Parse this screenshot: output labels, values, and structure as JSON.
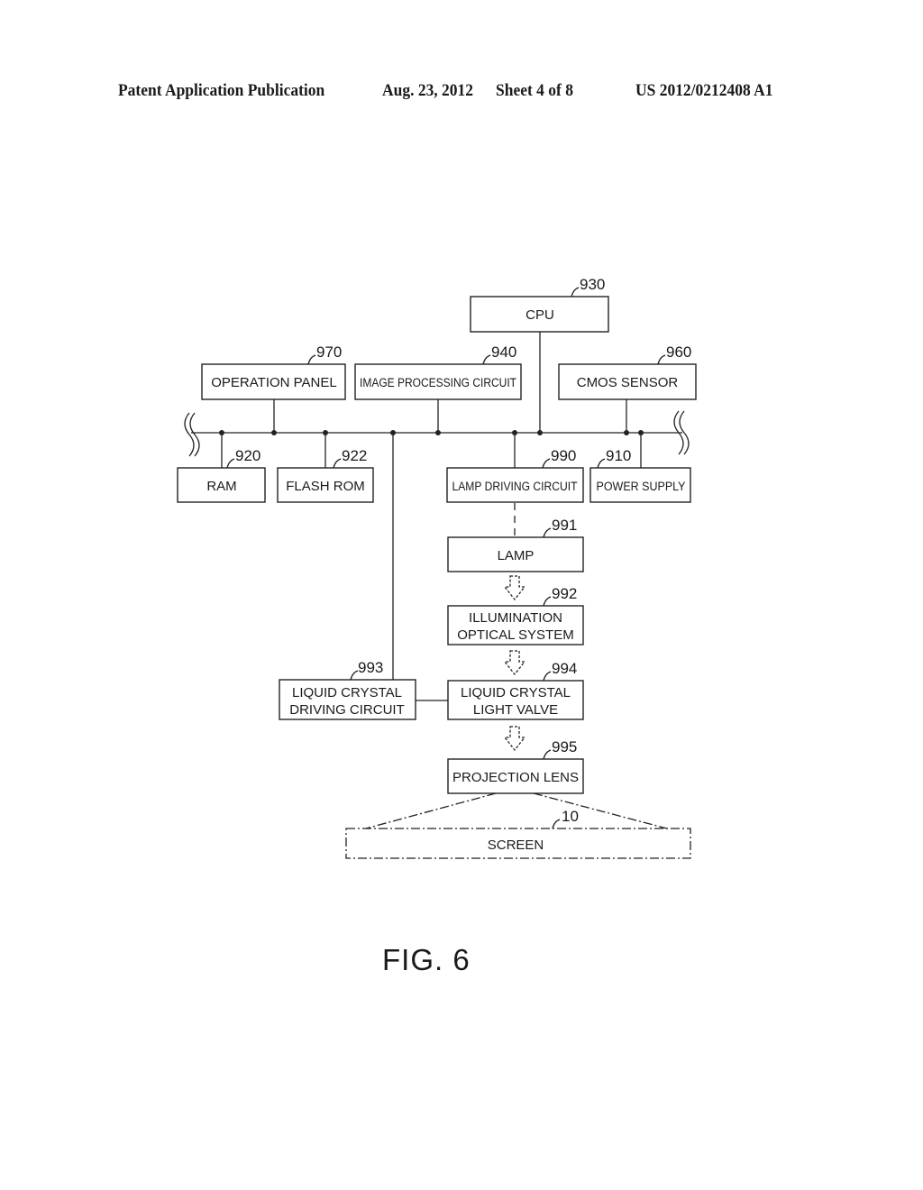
{
  "header": {
    "publication": "Patent Application Publication",
    "date": "Aug. 23, 2012",
    "sheet": "Sheet 4 of 8",
    "number": "US 2012/0212408 A1"
  },
  "figure_label": "FIG. 6",
  "blocks": {
    "cpu": {
      "label": "CPU",
      "ref": "930"
    },
    "operation_panel": {
      "label": "OPERATION PANEL",
      "ref": "970"
    },
    "image_processing": {
      "label": "IMAGE PROCESSING CIRCUIT",
      "ref": "940"
    },
    "cmos_sensor": {
      "label": "CMOS SENSOR",
      "ref": "960"
    },
    "ram": {
      "label": "RAM",
      "ref": "920"
    },
    "flash_rom": {
      "label": "FLASH ROM",
      "ref": "922"
    },
    "lamp_driving": {
      "label": "LAMP DRIVING CIRCUIT",
      "ref": "990"
    },
    "power_supply": {
      "label": "POWER SUPPLY",
      "ref": "910"
    },
    "lamp": {
      "label": "LAMP",
      "ref": "991"
    },
    "illumination": {
      "line1": "ILLUMINATION",
      "line2": "OPTICAL SYSTEM",
      "ref": "992"
    },
    "lc_driving": {
      "line1": "LIQUID CRYSTAL",
      "line2": "DRIVING CIRCUIT",
      "ref": "993"
    },
    "lc_valve": {
      "line1": "LIQUID CRYSTAL",
      "line2": "LIGHT VALVE",
      "ref": "994"
    },
    "projection_lens": {
      "label": "PROJECTION LENS",
      "ref": "995"
    },
    "screen": {
      "label": "SCREEN",
      "ref": "10"
    }
  }
}
